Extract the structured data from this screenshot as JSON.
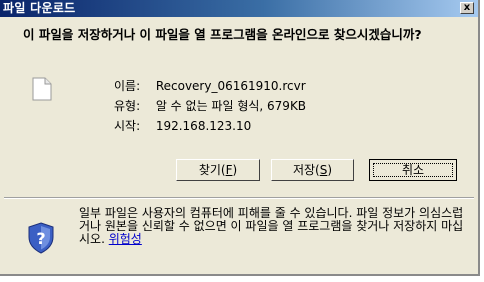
{
  "dialog": {
    "title": "파일 다운로드",
    "close_label": "x",
    "question": "이 파일을 저장하거나 이 파일을 열 프로그램을 온라인으로 찾으시겠습니까?",
    "file": {
      "name_label": "이름:",
      "name_value": "Recovery_06161910.rcvr",
      "type_label": "유형:",
      "type_value": "알 수 없는 파일 형식, 679KB",
      "from_label": "시작:",
      "from_value": "192.168.123.10"
    },
    "buttons": {
      "find_label": "찾기(",
      "find_key": "F",
      "find_tail": ")",
      "save_label": "저장(",
      "save_key": "S",
      "save_tail": ")",
      "cancel_label": "취소"
    },
    "warning": {
      "text": "일부 파일은 사용자의 컴퓨터에 피해를 줄 수 있습니다. 파일 정보가 의심스럽거나 원본을 신뢰할 수 없으면 이 파일을 열 프로그램을 찾거나 저장하지 마십시오. ",
      "link": "위험성"
    },
    "icons": {
      "file": "blank-file-icon",
      "shield": "security-shield-question-icon"
    },
    "colors": {
      "title_gradient_start": "#0a246a",
      "title_gradient_end": "#a6caf0",
      "dialog_bg": "#ece9d8",
      "link": "#0000cc"
    }
  }
}
